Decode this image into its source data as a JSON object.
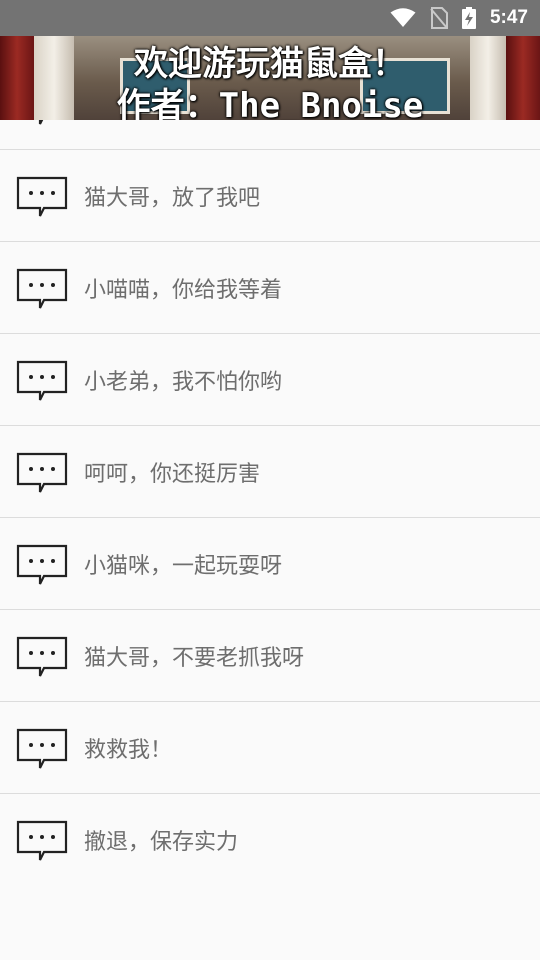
{
  "status_bar": {
    "time": "5:47",
    "icons": [
      "wifi-icon",
      "no-sim-icon",
      "battery-charging-icon"
    ],
    "color": "#737373"
  },
  "banner": {
    "title": "欢迎游玩猫鼠盒！",
    "author": "作者：The_Bnoise"
  },
  "list": {
    "items": [
      {
        "label": "",
        "icon": "speech-bubble-icon"
      },
      {
        "label": "猫大哥，放了我吧",
        "icon": "speech-bubble-icon"
      },
      {
        "label": "小喵喵，你给我等着",
        "icon": "speech-bubble-icon"
      },
      {
        "label": "小老弟，我不怕你哟",
        "icon": "speech-bubble-icon"
      },
      {
        "label": "呵呵，你还挺厉害",
        "icon": "speech-bubble-icon"
      },
      {
        "label": "小猫咪，一起玩耍呀",
        "icon": "speech-bubble-icon"
      },
      {
        "label": "猫大哥，不要老抓我呀",
        "icon": "speech-bubble-icon"
      },
      {
        "label": "救救我！",
        "icon": "speech-bubble-icon"
      },
      {
        "label": "撤退，保存实力",
        "icon": "speech-bubble-icon"
      }
    ]
  },
  "colors": {
    "background": "#fafafa",
    "divider": "#dcdcdc",
    "text": "#6e6e6e"
  }
}
